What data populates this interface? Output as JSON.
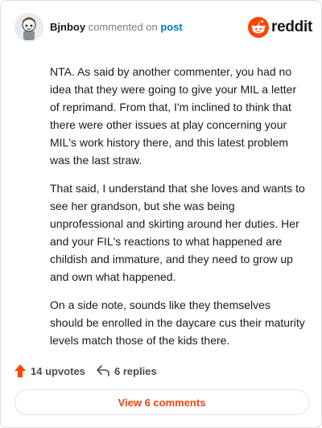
{
  "header": {
    "username": "Bjnboy",
    "verb": "commented on",
    "post_link": "post",
    "brand": "reddit"
  },
  "comment": {
    "paragraphs": [
      "NTA. As said by another commenter, you had no idea that they were going to give your MIL a letter of reprimand. From that, I'm inclined to think that there were other issues at play concerning your MIL's work history there, and this latest problem was the last straw.",
      "That said, I understand that she loves and wants to see her grandson, but she was being unprofessional and skirting around her duties. Her and your FIL's reactions to what happened are childish and immature, and they need to grow up and own what happened.",
      "On a side note, sounds like they themselves should be enrolled in the daycare cus their maturity levels match those of the kids there."
    ]
  },
  "actions": {
    "upvotes": "14 upvotes",
    "replies": "6 replies"
  },
  "view_comments": "View 6 comments",
  "colors": {
    "brand_orange": "#ff4500",
    "link_blue": "#0079d3",
    "upvote_orange": "#ff4500"
  },
  "icons": {
    "avatar": "avatar-icon",
    "logo": "reddit-alien-icon",
    "upvote": "upvote-arrow-icon",
    "reply": "reply-arrow-icon"
  }
}
